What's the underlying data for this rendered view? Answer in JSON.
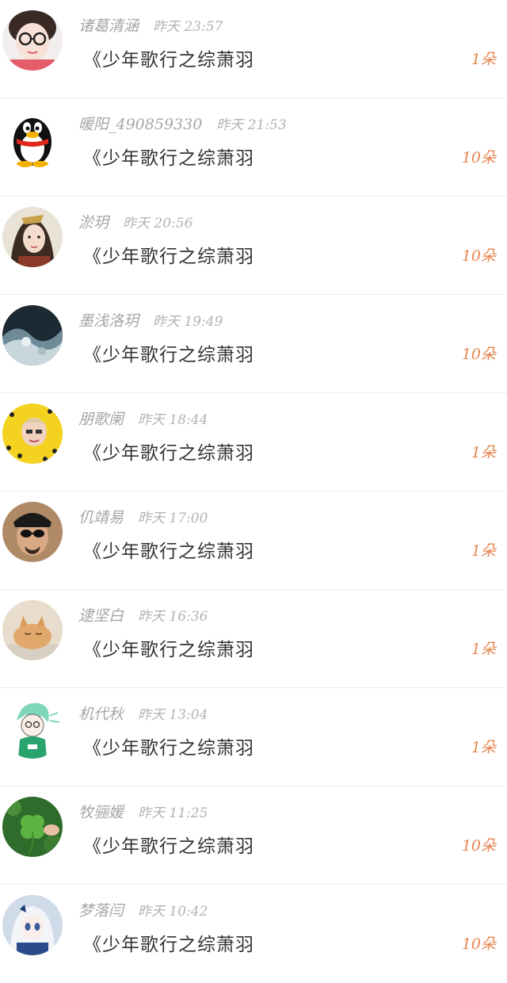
{
  "colors": {
    "name": "#a6a6a6",
    "time": "#b3b3b3",
    "title": "#333333",
    "count_accent": "#e6854f",
    "divider": "#ececec"
  },
  "gifts": [
    {
      "name": "诸葛清涵",
      "time": "昨天 23:57",
      "book": "《少年歌行之综萧羽",
      "count": "1朵",
      "avatar_icon": "girl-glasses-avatar"
    },
    {
      "name": "暖阳_490859330",
      "time": "昨天 21:53",
      "book": "《少年歌行之综萧羽",
      "count": "10朵",
      "avatar_icon": "qq-penguin-avatar"
    },
    {
      "name": "淤玥",
      "time": "昨天 20:56",
      "book": "《少年歌行之综萧羽",
      "count": "10朵",
      "avatar_icon": "ancient-girl-avatar"
    },
    {
      "name": "墨浅洛玥",
      "time": "昨天 19:49",
      "book": "《少年歌行之综萧羽",
      "count": "10朵",
      "avatar_icon": "ink-wave-avatar"
    },
    {
      "name": "朋歌阑",
      "time": "昨天 18:44",
      "book": "《少年歌行之综萧羽",
      "count": "1朵",
      "avatar_icon": "yellow-boy-avatar"
    },
    {
      "name": "仉靖易",
      "time": "昨天 17:00",
      "book": "《少年歌行之综萧羽",
      "count": "1朵",
      "avatar_icon": "sunglasses-man-avatar"
    },
    {
      "name": "逮坚白",
      "time": "昨天 16:36",
      "book": "《少年歌行之综萧羽",
      "count": "1朵",
      "avatar_icon": "cat-avatar"
    },
    {
      "name": "机代秋",
      "time": "昨天 13:04",
      "book": "《少年歌行之综萧羽",
      "count": "1朵",
      "avatar_icon": "green-cartoon-boy-avatar"
    },
    {
      "name": "牧骊媛",
      "time": "昨天 11:25",
      "book": "《少年歌行之综萧羽",
      "count": "10朵",
      "avatar_icon": "clover-avatar"
    },
    {
      "name": "梦落闫",
      "time": "昨天 10:42",
      "book": "《少年歌行之综萧羽",
      "count": "10朵",
      "avatar_icon": "anime-girl-avatar"
    }
  ]
}
